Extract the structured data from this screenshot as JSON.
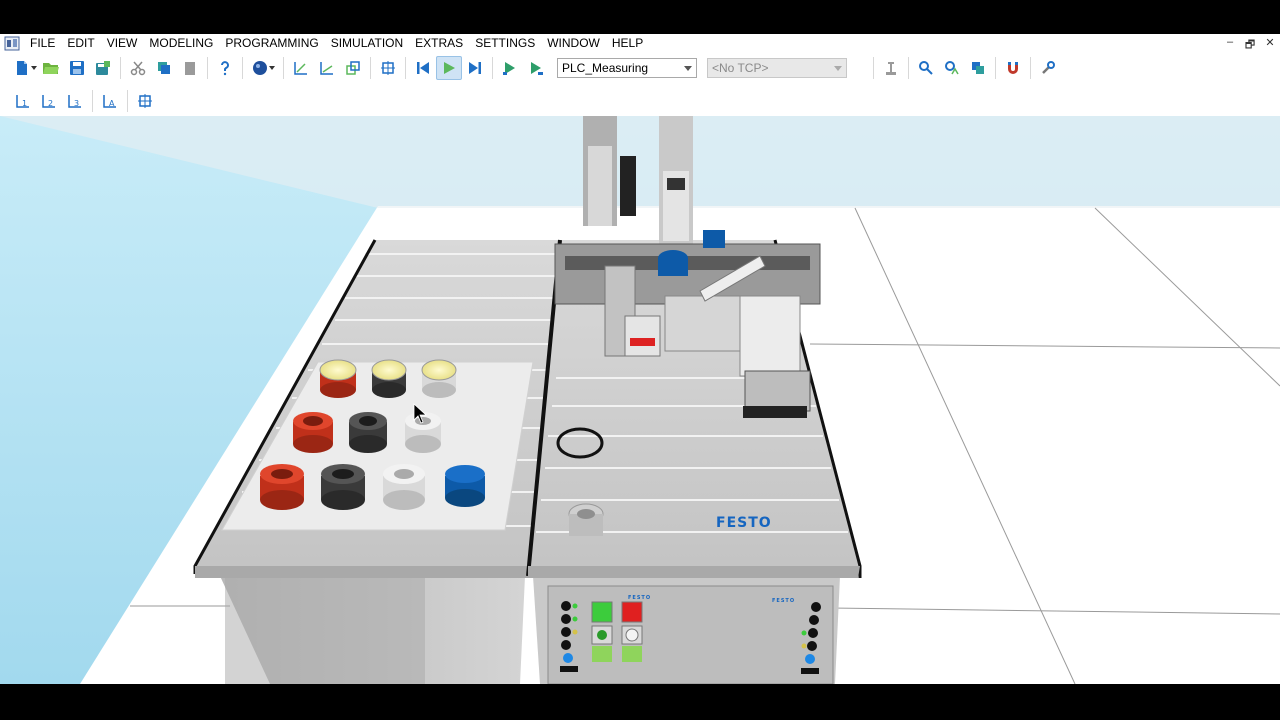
{
  "menu": {
    "items": [
      "FILE",
      "EDIT",
      "VIEW",
      "MODELING",
      "PROGRAMMING",
      "SIMULATION",
      "EXTRAS",
      "SETTINGS",
      "WINDOW",
      "HELP"
    ]
  },
  "window_controls": {
    "minimize": "–",
    "restore": "🗗",
    "close": "✕"
  },
  "toolbar": {
    "program_select": "PLC_Measuring",
    "tcp_select": "<No TCP>"
  },
  "scene": {
    "brand": "FESTO",
    "panel_brand_left": "FESTO",
    "panel_brand_right": "FESTO"
  },
  "colors": {
    "accent_blue": "#1565c0",
    "sky": "#a9dcef",
    "floor": "#ffffff",
    "active_play": "#cfe3f5",
    "workpiece_red": "#c0301a",
    "workpiece_black": "#3a3a3a",
    "workpiece_silver": "#d9d9d9",
    "workpiece_blue": "#0d5aa8"
  }
}
